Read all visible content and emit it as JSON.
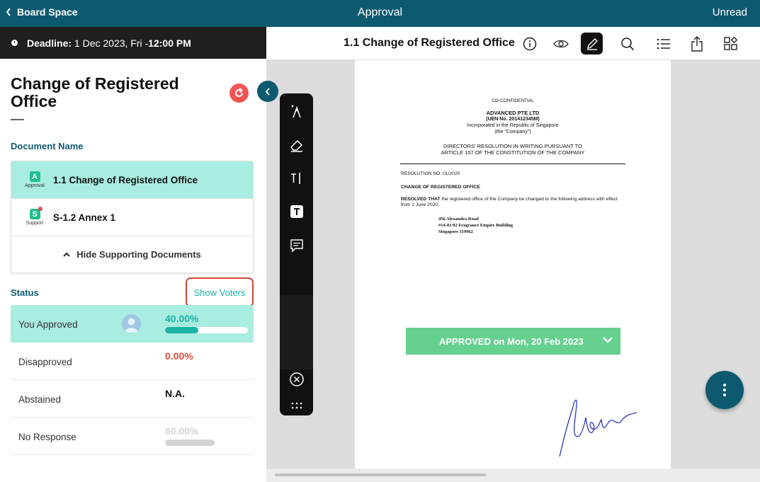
{
  "topbar": {
    "back_label": "Board Space",
    "title": "Approval",
    "unread_label": "Unread"
  },
  "deadline": {
    "label": "Deadline:",
    "date": "1 Dec 2023, Fri - ",
    "time": "12:00 PM"
  },
  "panel": {
    "heading": "Change of Registered Office",
    "document_section_label": "Document Name",
    "documents": [
      {
        "name": "1.1 Change of Registered Office",
        "badge_letter": "A",
        "badge_caption": "Approval",
        "badge_color": "#1fbf8e"
      },
      {
        "name": "S-1.2 Annex 1",
        "badge_letter": "S",
        "badge_caption": "Support",
        "badge_color": "#1fbf8e"
      }
    ],
    "hide_supporting_label": "Hide Supporting Documents",
    "status_label": "Status",
    "show_voters_label": "Show Voters",
    "statuses": [
      {
        "label": "You Approved",
        "value": "40.00%",
        "fraction": 0.4,
        "color": "#1ab3a6"
      },
      {
        "label": "Disapproved",
        "value": "0.00%",
        "color": "#e04b3a"
      },
      {
        "label": "Abstained",
        "value": "N.A.",
        "color": "#111111"
      },
      {
        "label": "No Response",
        "value": "60.00%",
        "fraction": 0.6,
        "color": "#d3d3d3"
      }
    ]
  },
  "document_header": {
    "title": "1.1 Change of Registered Office",
    "icons": [
      "info-icon",
      "eye-icon",
      "annotate-icon",
      "search-icon",
      "list-icon",
      "share-icon",
      "apps-icon"
    ]
  },
  "toolbar": {
    "icons": [
      "pen-icon",
      "eraser-icon",
      "text-cursor-icon",
      "text-box-icon",
      "comment-icon",
      "close-circle-icon",
      "more-dots-icon"
    ]
  },
  "page": {
    "confidential": "CO-CONFIDENTIAL",
    "company": "ADVANCED PTE LTD",
    "uen": "(UEN No. 201412345M)",
    "incorporated": "Incorporated in the Republic of Singapore",
    "company_alias": "(the \"Company\")",
    "resolution_title_1": "DIRECTORS' RESOLUTION IN WRITING PURSUANT TO",
    "resolution_title_2": "ARTICLE 107 OF THE CONSTITUTION OF THE COMPANY",
    "resolution_no": "RESOLUTION NO. 01/2020",
    "subject": "CHANGE OF REGISTERED OFFICE",
    "resolved_lead": "RESOLVED THAT",
    "resolved_text": " the registered office of the Company be changed to the following address with effect from 1 June 2020:",
    "address_1": "456 Alexandra Road",
    "address_2": "#14-01/02 Fragrance Empire Building",
    "address_3": "Singapore 119962"
  },
  "approval_banner": "APPROVED on Mon, 20 Feb 2023",
  "colors": {
    "brand": "#0d5a70",
    "highlight": "#a9ece0",
    "approved": "#66d08f",
    "alert": "#d0443b"
  }
}
